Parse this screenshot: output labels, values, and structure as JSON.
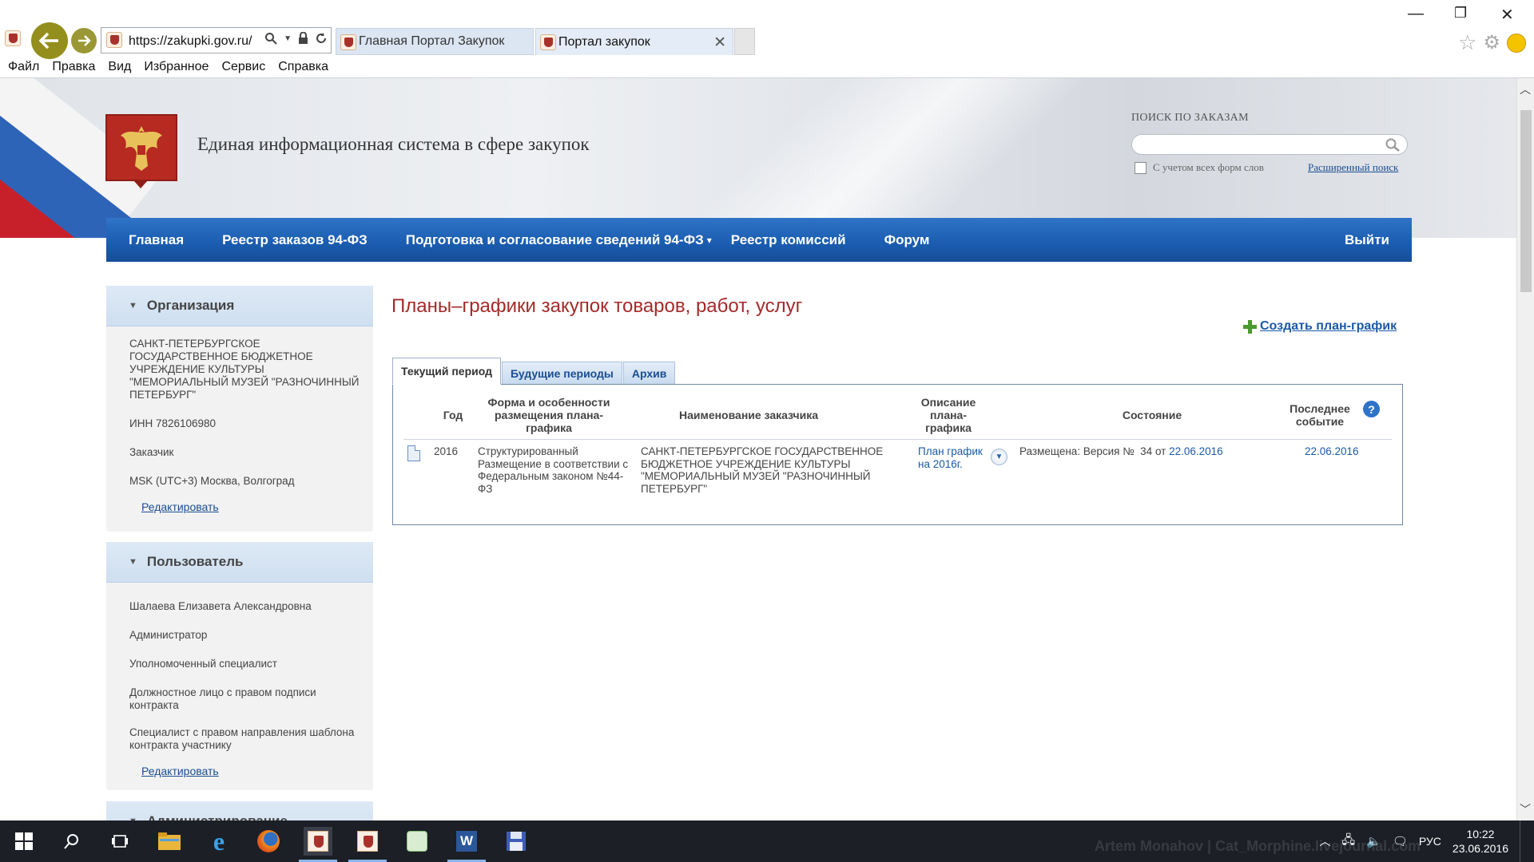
{
  "browser": {
    "url": "https://zakupki.gov.ru/",
    "tabs": [
      {
        "label": "Главная Портал Закупок"
      },
      {
        "label": "Портал закупок"
      }
    ],
    "menu": [
      "Файл",
      "Правка",
      "Вид",
      "Избранное",
      "Сервис",
      "Справка"
    ]
  },
  "header": {
    "title": "Единая информационная система в сфере закупок",
    "search_label": "ПОИСК ПО ЗАКАЗАМ",
    "search_value": "",
    "word_forms_label": "С учетом всех форм слов",
    "advanced_search": "Расширенный поиск"
  },
  "nav": {
    "home": "Главная",
    "registry94": "Реестр заказов 94-ФЗ",
    "prep": "Подготовка и согласование сведений 94-ФЗ",
    "commissions": "Реестр комиссий",
    "forum": "Форум",
    "logout": "Выйти"
  },
  "org_panel": {
    "title": "Организация",
    "name": "САНКТ-ПЕТЕРБУРГСКОЕ ГОСУДАРСТВЕННОЕ БЮДЖЕТНОЕ УЧРЕЖДЕНИЕ КУЛЬТУРЫ \"МЕМОРИАЛЬНЫЙ МУЗЕЙ \"РАЗНОЧИННЫЙ ПЕТЕРБУРГ\"",
    "inn": "ИНН 7826106980",
    "role": "Заказчик",
    "timezone": "MSK (UTC+3) Москва, Волгоград",
    "edit": "Редактировать"
  },
  "user_panel": {
    "title": "Пользователь",
    "name": "Шалаева Елизавета Александровна",
    "roles": [
      "Администратор",
      "Уполномоченный специалист",
      "Должностное лицо с правом подписи контракта",
      "Специалист с правом направления шаблона контракта участнику"
    ],
    "edit": "Редактировать"
  },
  "third_panel_title": "Администрирование",
  "main": {
    "title": "Планы–графики закупок товаров, работ, услуг",
    "create_link": "Создать план-график",
    "tabs": [
      "Текущий период",
      "Будущие периоды",
      "Архив"
    ],
    "columns": [
      "Год",
      "Форма и особенности размещения плана-графика",
      "Наименование заказчика",
      "Описание плана-графика",
      "Состояние",
      "Последнее событие"
    ],
    "rows": [
      {
        "year": "2016",
        "form": "Структурированный Размещение в соответствии с Федеральным законом №44-ФЗ",
        "customer": "САНКТ-ПЕТЕРБУРГСКОЕ ГОСУДАРСТВЕННОЕ БЮДЖЕТНОЕ УЧРЕЖДЕНИЕ КУЛЬТУРЫ \"МЕМОРИАЛЬНЫЙ МУЗЕЙ \"РАЗНОЧИННЫЙ ПЕТЕРБУРГ\"",
        "description": "План график на 2016г.",
        "state_prefix": "Размещена: Версия №  34 от ",
        "state_date": "22.06.2016",
        "last_event": "22.06.2016"
      }
    ]
  },
  "taskbar": {
    "lang": "РУС",
    "time": "10:22",
    "date": "23.06.2016",
    "watermark": "Artem Monahov | Cat_Morphine.livejournal.com"
  },
  "colors": {
    "nav_blue": "#1a5cb0",
    "title_red": "#a52a2a",
    "link_blue": "#1b5aa8"
  }
}
